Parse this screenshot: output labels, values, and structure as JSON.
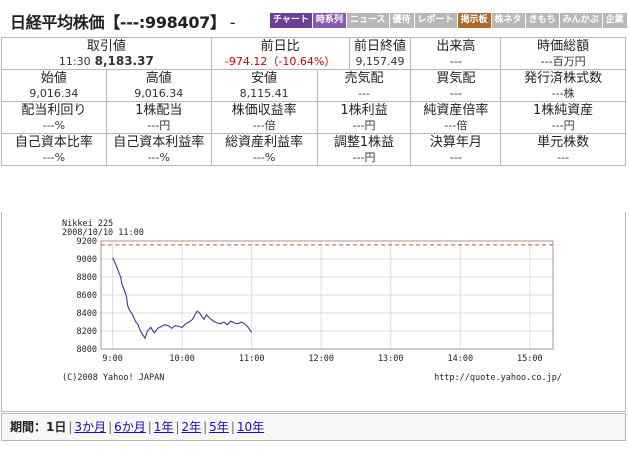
{
  "header": {
    "title": "日経平均株価【---:998407】",
    "separator": "-",
    "tabs": [
      {
        "label": "チャート",
        "kind": "chart"
      },
      {
        "label": "時系列",
        "kind": "series"
      },
      {
        "label": "ニュース",
        "kind": "plain"
      },
      {
        "label": "優待",
        "kind": "plain"
      },
      {
        "label": "レポート",
        "kind": "plain"
      },
      {
        "label": "掲示板",
        "kind": "board"
      },
      {
        "label": "株ネタ",
        "kind": "plain"
      },
      {
        "label": "きもち",
        "kind": "plain"
      },
      {
        "label": "みんかぶ",
        "kind": "plain"
      },
      {
        "label": "企業",
        "kind": "plain"
      }
    ]
  },
  "stats": {
    "row1": {
      "trade": {
        "label": "取引値",
        "time": "11:30",
        "value": "8,183.37"
      },
      "change": {
        "label": "前日比",
        "value": "-974.12（-10.64%）"
      },
      "prev_close": {
        "label": "前日終値",
        "value": "9,157.49"
      },
      "volume": {
        "label": "出来高",
        "value": "---"
      },
      "market_cap": {
        "label": "時価総額",
        "value": "---百万円"
      }
    },
    "row2": [
      {
        "label": "始値",
        "value": "9,016.34"
      },
      {
        "label": "高値",
        "value": "9,016.34"
      },
      {
        "label": "安値",
        "value": "8,115.41"
      },
      {
        "label": "売気配",
        "value": "---"
      },
      {
        "label": "買気配",
        "value": "---"
      },
      {
        "label": "発行済株式数",
        "value": "---株"
      }
    ],
    "row3": [
      {
        "label": "配当利回り",
        "value": "---%"
      },
      {
        "label": "1株配当",
        "value": "---円"
      },
      {
        "label": "株価収益率",
        "value": "---倍"
      },
      {
        "label": "1株利益",
        "value": "---円"
      },
      {
        "label": "純資産倍率",
        "value": "---倍"
      },
      {
        "label": "1株純資産",
        "value": "---円"
      }
    ],
    "row4": [
      {
        "label": "自己資本比率",
        "value": "---%"
      },
      {
        "label": "自己資本利益率",
        "value": "---%"
      },
      {
        "label": "総資産利益率",
        "value": "---%"
      },
      {
        "label": "調整1株益",
        "value": "---円"
      },
      {
        "label": "決算年月",
        "value": "---"
      },
      {
        "label": "単元株数",
        "value": "---"
      }
    ]
  },
  "chart_data": {
    "type": "line",
    "title": "Nikkei 225",
    "subtitle": "2008/10/10 11:00",
    "x_ticks": [
      "9:00",
      "10:00",
      "11:00",
      "12:00",
      "13:00",
      "14:00",
      "15:00"
    ],
    "y_ticks": [
      9200,
      9000,
      8800,
      8600,
      8400,
      8200,
      8000
    ],
    "ylim": [
      8000,
      9200
    ],
    "xlim": [
      "8:50",
      "15:20"
    ],
    "prev_close": 9157.49,
    "copyright": "(C)2008 Yahoo! JAPAN",
    "source_url": "http://quote.yahoo.co.jp/",
    "colors": {
      "line": "#3a3a8c",
      "prev_close": "#d9531e",
      "grid": "#dcdcdc"
    },
    "series": [
      {
        "x": [
          "9:00",
          "9:01",
          "9:02",
          "9:04",
          "9:05",
          "9:07",
          "9:08",
          "9:10",
          "9:12",
          "9:13",
          "9:15",
          "9:17",
          "9:19",
          "9:20",
          "9:22",
          "9:24",
          "9:26",
          "9:28",
          "9:30",
          "9:33",
          "9:36",
          "9:39",
          "9:42",
          "9:45",
          "9:48",
          "9:51",
          "9:54",
          "9:57",
          "10:00",
          "10:03",
          "10:06",
          "10:09",
          "10:11",
          "10:13",
          "10:15",
          "10:17",
          "10:19",
          "10:21",
          "10:24",
          "10:27",
          "10:30",
          "10:33",
          "10:36",
          "10:39",
          "10:42",
          "10:45",
          "10:48",
          "10:51",
          "10:54",
          "10:57",
          "11:00"
        ],
        "y": [
          9016,
          8990,
          8960,
          8900,
          8860,
          8800,
          8720,
          8660,
          8580,
          8480,
          8420,
          8390,
          8330,
          8300,
          8270,
          8200,
          8160,
          8120,
          8200,
          8240,
          8180,
          8230,
          8250,
          8270,
          8260,
          8230,
          8260,
          8250,
          8240,
          8280,
          8300,
          8330,
          8380,
          8420,
          8400,
          8360,
          8330,
          8380,
          8340,
          8310,
          8290,
          8280,
          8300,
          8270,
          8310,
          8290,
          8280,
          8300,
          8280,
          8240,
          8183
        ]
      }
    ]
  },
  "periods": {
    "label": "期間：",
    "current": "1日",
    "links": [
      "3か月",
      "6か月",
      "1年",
      "2年",
      "5年",
      "10年"
    ]
  }
}
